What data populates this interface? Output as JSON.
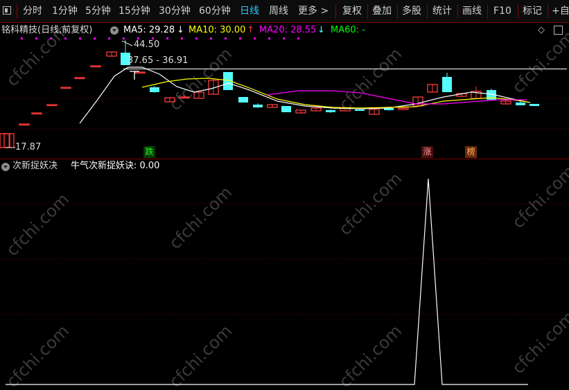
{
  "toolbar": {
    "timeframes": [
      "分时",
      "1分钟",
      "5分钟",
      "15分钟",
      "30分钟",
      "60分钟",
      "日线",
      "周线",
      "更多 >"
    ],
    "active_timeframe": "日线",
    "actions": [
      "复权",
      "叠加",
      "多股",
      "统计",
      "画线",
      "F10",
      "标记",
      "+自"
    ]
  },
  "main_panel": {
    "title": "铭科精技(日线,前复权)",
    "ma5": "MA5: 29.28",
    "ma10": "MA10: 30.00",
    "ma20": "MA20: 28.55",
    "ma60": "MA60: -",
    "high_label": "44.50",
    "range_label": "37.65 - 36.91",
    "low_label": "17.87",
    "badges": {
      "fall": "跌",
      "rise": "涨",
      "list": "榜"
    }
  },
  "sub_panel": {
    "title": "次新捉妖决",
    "indicator": "牛气次新捉妖诀: 0.00"
  },
  "colors": {
    "up": "#ff3a3a",
    "down": "#54fcfc",
    "ma5": "#ffffff",
    "ma10": "#ffff00",
    "ma20": "#ff00ff",
    "ma60": "#00ff00",
    "active_tab": "#36c8f8",
    "grid": "#7a0000",
    "watermark": "#3a3a3a"
  },
  "watermark": "cfchi.com",
  "icons": {
    "window": "window-icon",
    "panel_menu": "chevron-down-circle-icon",
    "diamond": "diamond-icon",
    "square": "square-icon"
  }
}
